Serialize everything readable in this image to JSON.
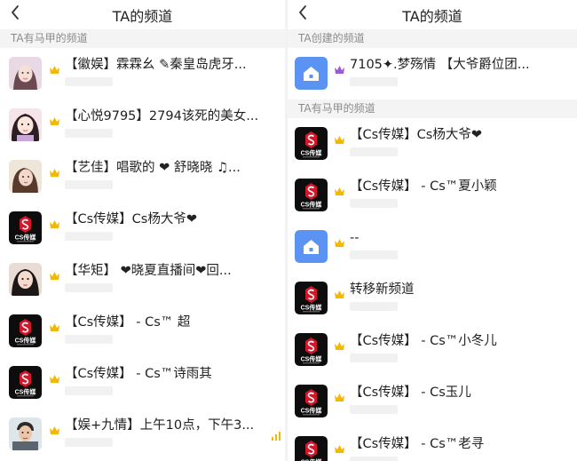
{
  "left": {
    "title": "TA的频道",
    "section": "TA有马甲的频道",
    "items": [
      {
        "name": "【徽娱】霖霖幺 ✎秦皇岛虎牙...",
        "avatar": "photo-girl-1",
        "badge": "crown-gold"
      },
      {
        "name": "【心悦9795】2794该死的美女...",
        "avatar": "photo-girl-2",
        "badge": "crown-gold"
      },
      {
        "name": "【艺佳】唱歌的 ❤ 舒晓晓 ♫...",
        "avatar": "photo-girl-3",
        "badge": "crown-gold"
      },
      {
        "name": "【Cs传媒】Cs杨大爷❤",
        "avatar": "cs-logo",
        "badge": "crown-gold"
      },
      {
        "name": "【华矩】 ❤晓夏直播间❤回...",
        "avatar": "photo-girl-4",
        "badge": "crown-gold"
      },
      {
        "name": "【Cs传媒】 - Cs™ 超",
        "avatar": "cs-logo",
        "badge": "crown-gold"
      },
      {
        "name": "【Cs传媒】 - Cs™诗雨其",
        "avatar": "cs-logo",
        "badge": "crown-gold"
      },
      {
        "name": "【娱+九情】上午10点，下午3...",
        "avatar": "photo-man",
        "badge": "crown-gold"
      }
    ]
  },
  "right": {
    "title": "TA的频道",
    "section_created": "TA创建的频道",
    "created": [
      {
        "name": "7105✦.梦殇情 【大爷爵位团...",
        "avatar": "home-icon",
        "badge": "crown-purple"
      }
    ],
    "section_vest": "TA有马甲的频道",
    "items": [
      {
        "name": "【Cs传媒】Cs杨大爷❤",
        "avatar": "cs-logo",
        "badge": "crown-gold"
      },
      {
        "name": "【Cs传媒】 - Cs™夏小颖",
        "avatar": "cs-logo",
        "badge": "crown-gold"
      },
      {
        "name": "--",
        "avatar": "home-icon",
        "badge": "crown-gold"
      },
      {
        "name": "转移新频道",
        "avatar": "cs-logo",
        "badge": "crown-gold"
      },
      {
        "name": "【Cs传媒】 - Cs™小冬儿",
        "avatar": "cs-logo",
        "badge": "crown-gold"
      },
      {
        "name": "【Cs传媒】 - Cs玉儿",
        "avatar": "cs-logo",
        "badge": "crown-gold"
      },
      {
        "name": "【Cs传媒】 - Cs™老寻",
        "avatar": "cs-logo",
        "badge": "crown-gold"
      }
    ]
  },
  "cs_logo_text": "CS传媒",
  "colors": {
    "crown_gold": "#f5b800",
    "crown_purple": "#9c59d1",
    "home_blue": "#4f8ef7",
    "cs_red": "#d3172a"
  }
}
